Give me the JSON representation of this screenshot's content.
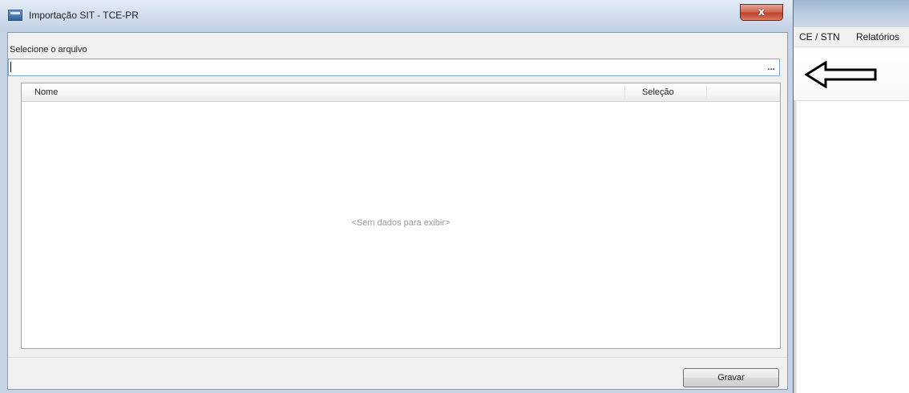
{
  "dialog": {
    "title": "Importação SIT - TCE-PR",
    "close_glyph": "x",
    "file_label": "Selecione o arquivo",
    "file_input": {
      "value": "",
      "placeholder": ""
    },
    "browse_label": "...",
    "grid": {
      "columns": [
        "Nome",
        "Seleção"
      ],
      "rows": [],
      "empty_text": "<Sem dados para exibir>"
    },
    "save_label": "Gravar"
  },
  "background_app": {
    "menu_items": [
      "CE / STN",
      "Relatórios"
    ]
  },
  "annotation": {
    "arrow_direction": "left",
    "arrow_color": "#000000"
  },
  "colors": {
    "titlebar_top": "#e4ecf6",
    "close_button": "#c0412b",
    "client_background": "#f0f0f0",
    "input_border": "#7fa7d3"
  },
  "icons": {
    "app_icon": "window-app-icon",
    "close": "close-icon",
    "browse": "ellipsis-icon",
    "annotation": "arrow-left-icon"
  }
}
